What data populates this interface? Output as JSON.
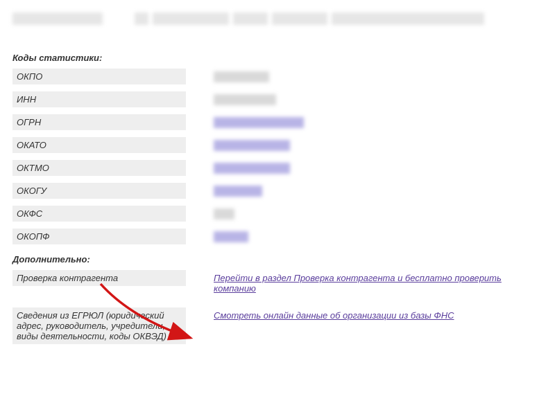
{
  "headings": {
    "statistics": "Коды статистики:",
    "additional": "Дополнительно:"
  },
  "stats": [
    {
      "label": "ОКПО",
      "blurWidth": 80,
      "blurClass": "vb-gray"
    },
    {
      "label": "ИНН",
      "blurWidth": 90,
      "blurClass": "vb-gray"
    },
    {
      "label": "ОГРН",
      "blurWidth": 130,
      "blurClass": "vb-link"
    },
    {
      "label": "ОКАТО",
      "blurWidth": 110,
      "blurClass": "vb-link"
    },
    {
      "label": "ОКТМО",
      "blurWidth": 110,
      "blurClass": "vb-link"
    },
    {
      "label": "ОКОГУ",
      "blurWidth": 70,
      "blurClass": "vb-link"
    },
    {
      "label": "ОКФС",
      "blurWidth": 30,
      "blurClass": "vb-gray"
    },
    {
      "label": "ОКОПФ",
      "blurWidth": 50,
      "blurClass": "vb-link"
    }
  ],
  "additional": [
    {
      "label": "Проверка контрагента",
      "linkText": "Перейти в раздел Проверка контрагента и бесплатно проверить компанию"
    },
    {
      "label": "Сведения из ЕГРЮЛ (юридический адрес, руководитель, учредители, виды деятельности, коды ОКВЭД)",
      "linkText": "Смотреть онлайн данные об организации из базы ФНС"
    }
  ]
}
